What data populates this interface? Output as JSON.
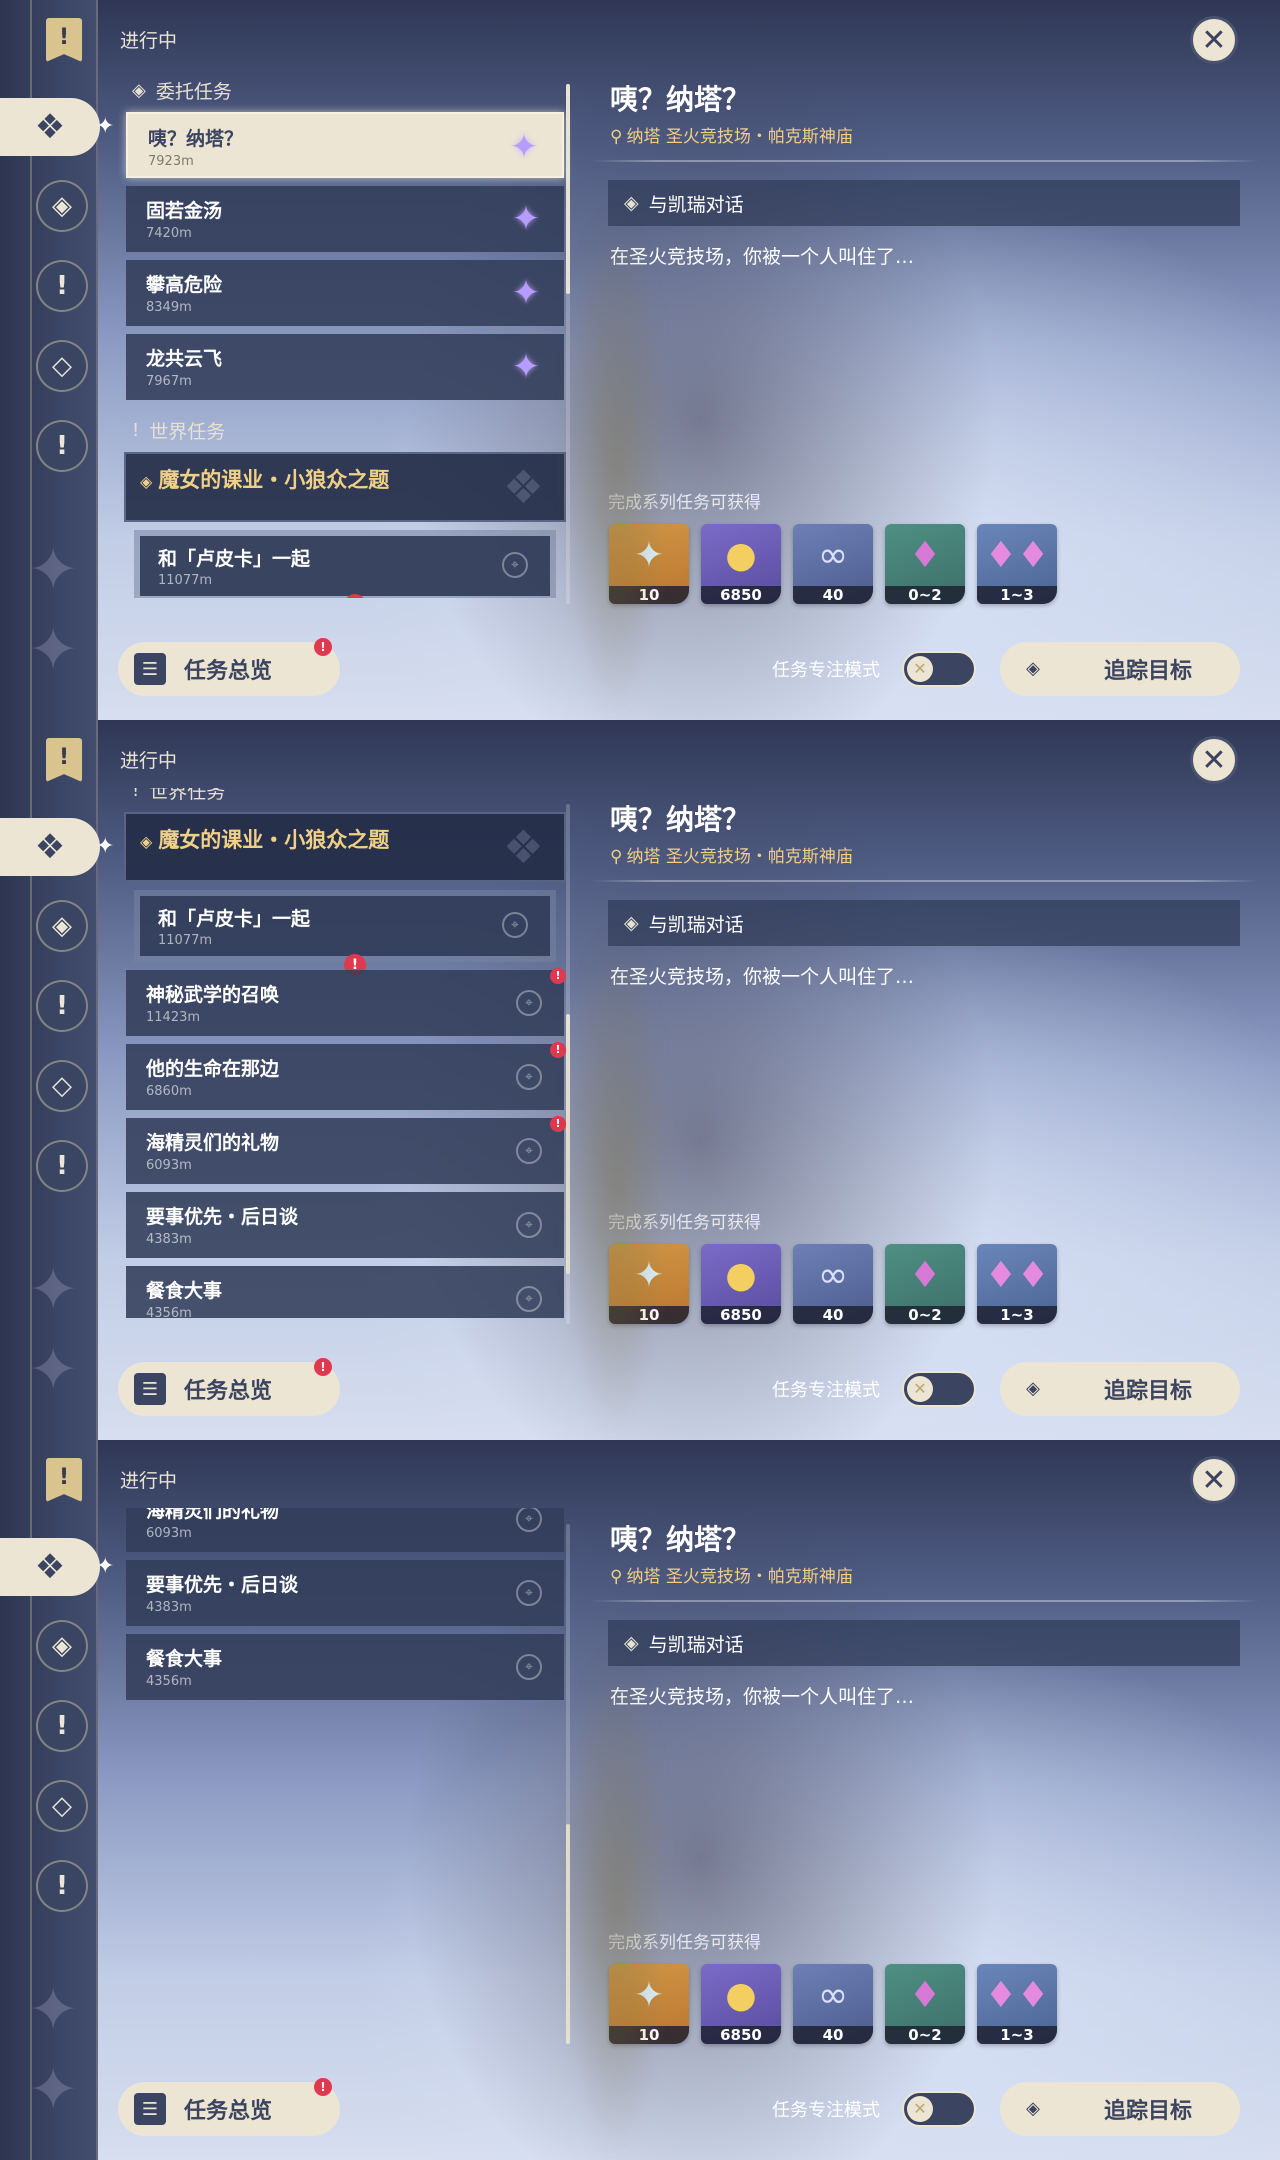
{
  "header": {
    "status_label": "进行中",
    "close_icon": "close-icon"
  },
  "commission_section": {
    "title": "委托任务"
  },
  "world_section": {
    "title": "世界任务"
  },
  "commissions": [
    {
      "title": "咦？纳塔？",
      "distance": "7923m"
    },
    {
      "title": "固若金汤",
      "distance": "7420m"
    },
    {
      "title": "攀高危险",
      "distance": "8349m"
    },
    {
      "title": "龙共云飞",
      "distance": "7967m"
    }
  ],
  "world_quest": {
    "title": "魔女的课业・小狼众之题",
    "sub": {
      "title": "和「卢皮卡」一起",
      "distance": "11077m"
    }
  },
  "world_items": [
    {
      "title": "神秘武学的召唤",
      "distance": "11423m",
      "badge": "!"
    },
    {
      "title": "他的生命在那边",
      "distance": "6860m",
      "badge": "!"
    },
    {
      "title": "海精灵们的礼物",
      "distance": "6093m",
      "badge": "!"
    },
    {
      "title": "要事优先・后日谈",
      "distance": "4383m",
      "badge": ""
    },
    {
      "title": "餐食大事",
      "distance": "4356m",
      "badge": ""
    }
  ],
  "detail": {
    "title": "咦？纳塔？",
    "location": "纳塔 圣火竞技场・帕克斯神庙",
    "objective": "与凯瑞对话",
    "description": "在圣火竞技场，你被一个人叫住了…",
    "rewards_label": "完成系列任务可获得",
    "rewards": [
      {
        "name": "primogem",
        "count": "10"
      },
      {
        "name": "mora",
        "count": "6850"
      },
      {
        "name": "adventure-exp",
        "count": "40"
      },
      {
        "name": "crystal-small",
        "count": "0~2"
      },
      {
        "name": "crystal-cluster",
        "count": "1~3"
      }
    ]
  },
  "footer": {
    "overview_label": "任务总览",
    "overview_badge": "!",
    "focus_label": "任务专注模式",
    "focus_enabled": false,
    "track_label": "追踪目标"
  },
  "colors": {
    "accent_gold": "#f0cf87",
    "cream": "#ece5d3",
    "navy": "#3b4460",
    "badge_red": "#e0384e"
  }
}
